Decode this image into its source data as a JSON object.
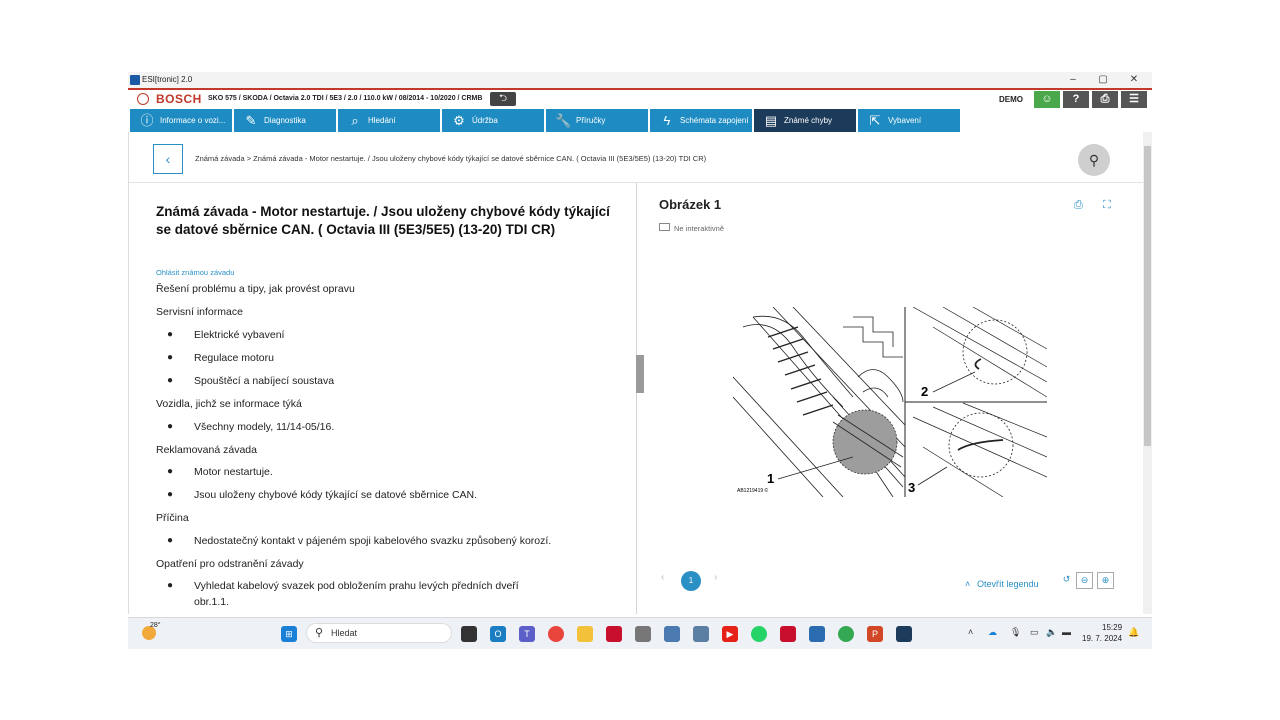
{
  "window": {
    "title": "ESI[tronic] 2.0",
    "controls": {
      "minimize": "–",
      "maximize": "▢",
      "close": "✕"
    }
  },
  "header": {
    "brand": "BOSCH",
    "vehicle": "SKO 575 / SKODA / Octavia 2.0 TDI / 5E3 / 2.0 / 110.0 kW / 08/2014 - 10/2020 / CRMB",
    "mode": "DEMO"
  },
  "nav": {
    "tabs": [
      {
        "label": "Informace o vozi...",
        "icon": "info-icon"
      },
      {
        "label": "Diagnostika",
        "icon": "diagnostics-icon"
      },
      {
        "label": "Hledání",
        "icon": "search-icon"
      },
      {
        "label": "Údržba",
        "icon": "gears-icon"
      },
      {
        "label": "Příručky",
        "icon": "wrench-icon"
      },
      {
        "label": "Schémata zapojení",
        "icon": "lightning-icon"
      },
      {
        "label": "Známé chyby",
        "icon": "book-icon"
      },
      {
        "label": "Vybavení",
        "icon": "external-icon"
      }
    ]
  },
  "breadcrumb": "Známá závada > Známá závada - Motor nestartuje. / Jsou uloženy chybové kódy týkající se datové sběrnice CAN. ( Octavia III (5E3/5E5) (13-20) TDI CR)",
  "article": {
    "title": "Známá závada - Motor nestartuje. / Jsou uloženy chybové kódy týkající se datové sběrnice CAN. ( Octavia III (5E3/5E5) (13-20) TDI CR)",
    "report_link": "Ohlásit známou závadu",
    "lines": [
      {
        "type": "text",
        "text": "Řešení problému a tipy, jak provést opravu"
      },
      {
        "type": "text",
        "text": "Servisní informace"
      },
      {
        "type": "bullet",
        "text": "Elektrické vybavení"
      },
      {
        "type": "bullet",
        "text": "Regulace motoru"
      },
      {
        "type": "bullet",
        "text": "Spouštěcí a nabíjecí soustava"
      },
      {
        "type": "text",
        "text": "Vozidla, jichž se informace týká"
      },
      {
        "type": "bullet",
        "text": "Všechny modely, 11/14-05/16."
      },
      {
        "type": "text",
        "text": "Reklamovaná závada"
      },
      {
        "type": "bullet",
        "text": "Motor nestartuje."
      },
      {
        "type": "bullet",
        "text": "Jsou uloženy chybové kódy týkající se datové sběrnice CAN."
      },
      {
        "type": "text",
        "text": "Příčina"
      },
      {
        "type": "bullet",
        "text": "Nedostatečný kontakt v pájeném spoji kabelového svazku způsobený korozí."
      },
      {
        "type": "text",
        "text": "Opatření pro odstranění závady"
      },
      {
        "type": "bullet",
        "text": "Vyhledat kabelový svazek pod obložením prahu levých předních dveří"
      },
      {
        "type": "cont",
        "text": "obr.1.1."
      }
    ]
  },
  "figure": {
    "title": "Obrázek 1",
    "non_interactive": "Ne interaktivně",
    "labels": [
      "1",
      "2",
      "3"
    ],
    "code": "AB1219419 ©",
    "page": "1",
    "prev": "‹",
    "next": "›",
    "legend": "Otevřít legendu"
  },
  "taskbar": {
    "weather": "28°",
    "search_placeholder": "Hledat",
    "time": "15:29",
    "date": "19. 7. 2024"
  }
}
